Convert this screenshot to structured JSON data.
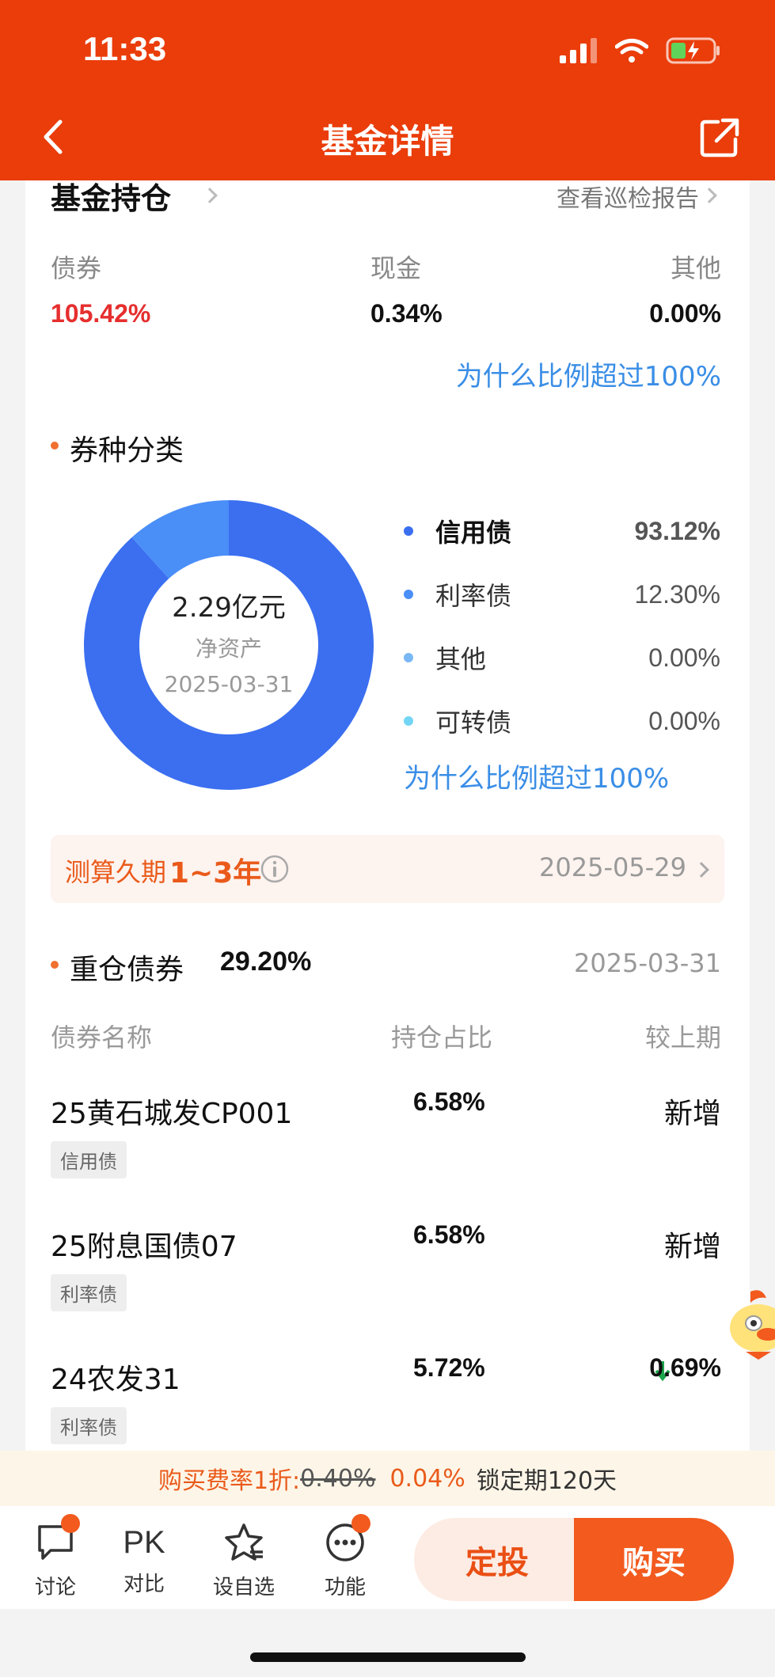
{
  "status": {
    "time": "11:33"
  },
  "header": {
    "title": "基金详情"
  },
  "holdings": {
    "title": "基金持仓",
    "report_link": "查看巡检报告",
    "cols": [
      {
        "label": "债券",
        "value": "105.42%"
      },
      {
        "label": "现金",
        "value": "0.34%"
      },
      {
        "label": "其他",
        "value": "0.00%"
      }
    ],
    "why_link": "为什么比例超过100%"
  },
  "category": {
    "title": "券种分类",
    "donut": {
      "amount": "2.29亿元",
      "label": "净资产",
      "date": "2025-03-31"
    },
    "legend": [
      {
        "name": "信用债",
        "value": "93.12%",
        "color": "#3b6ff0"
      },
      {
        "name": "利率债",
        "value": "12.30%",
        "color": "#4a8ef7"
      },
      {
        "name": "其他",
        "value": "0.00%",
        "color": "#7ab8f5"
      },
      {
        "name": "可转债",
        "value": "0.00%",
        "color": "#72d5f5"
      }
    ],
    "why_link": "为什么比例超过100%"
  },
  "duration": {
    "label": "测算久期",
    "value": "1~3年",
    "date": "2025-05-29"
  },
  "top_bonds": {
    "title": "重仓债券",
    "total": "29.20%",
    "date": "2025-03-31",
    "headers": [
      "债券名称",
      "持仓占比",
      "较上期"
    ],
    "rows": [
      {
        "name": "25黄石城发CP001",
        "tag": "信用债",
        "pct": "6.58%",
        "change": "新增"
      },
      {
        "name": "25附息国债07",
        "tag": "利率债",
        "pct": "6.58%",
        "change": "新增"
      },
      {
        "name": "24农发31",
        "tag": "利率债",
        "pct": "5.72%",
        "change": "0.69%"
      }
    ]
  },
  "fee": {
    "label": "购买费率1折:",
    "old": "0.40%",
    "new": "0.04%",
    "lock": "锁定期120天"
  },
  "toolbar": {
    "discuss": "讨论",
    "pk_icon": "PK",
    "compare": "对比",
    "watch": "设自选",
    "more": "功能",
    "ding": "定投",
    "buy": "购买"
  },
  "colors": {
    "brand": "#ea3d0a",
    "accent": "#f25a1e",
    "link": "#3a8ee6",
    "up": "#e62e2e",
    "down": "#1aa64a"
  }
}
